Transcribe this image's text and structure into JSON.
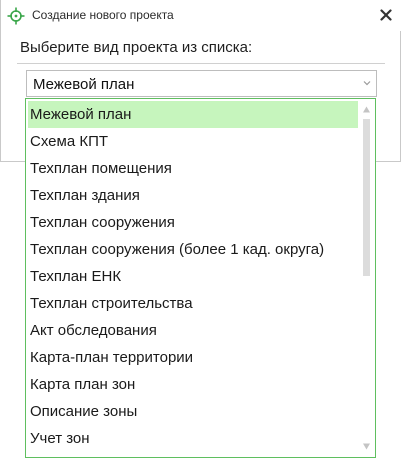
{
  "window": {
    "title": "Создание нового проекта",
    "close_icon": "close-icon",
    "app_icon": "crosshair-icon"
  },
  "prompt": "Выберите вид проекта из списка:",
  "combo": {
    "value": "Межевой план",
    "arrow_icon": "chevron-down-icon"
  },
  "dropdown": {
    "items": [
      "Межевой план",
      "Схема КПТ",
      "Техплан помещения",
      "Техплан здания",
      "Техплан сооружения",
      "Техплан сооружения (более 1 кад. округа)",
      "Техплан ЕНК",
      "Техплан строительства",
      "Акт обследования",
      "Карта-план территории",
      "Карта план зон",
      "Описание зоны",
      "Учет зон"
    ],
    "selected_index": 0
  },
  "colors": {
    "selected_bg": "#c6f5bd",
    "dropdown_border": "#5fbf5f",
    "icon_green": "#3aa64a"
  }
}
